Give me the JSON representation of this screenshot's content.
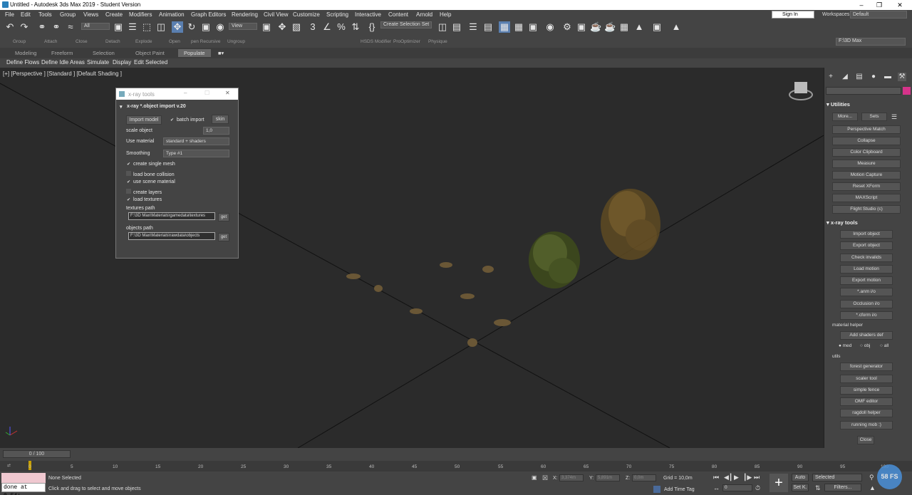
{
  "window": {
    "title": "Untitled - Autodesk 3ds Max 2019 - Student Version"
  },
  "menu": [
    "File",
    "Edit",
    "Tools",
    "Group",
    "Views",
    "Create",
    "Modifiers",
    "Animation",
    "Graph Editors",
    "Rendering",
    "Civil View",
    "Customize",
    "Scripting",
    "Interactive",
    "Content",
    "Arnold",
    "Help"
  ],
  "signin": "Sign In",
  "workspace": {
    "label": "Workspaces:",
    "value": "Default"
  },
  "toolbar": {
    "filter": "All",
    "view": "View",
    "selection_set": "Create Selection Set"
  },
  "toolbar2": [
    "Group",
    "Attach",
    "Close",
    "Detach",
    "Explode",
    "Open",
    "pen Recursive",
    "Ungroup",
    "HSDS Modifier",
    "ProOptimizer",
    "Physique"
  ],
  "project_path": "F:\\3D Max",
  "ribbon_tabs": [
    "Modeling",
    "Freeform",
    "Selection",
    "Object Paint",
    "Populate"
  ],
  "ribbon_active": "Populate",
  "ribbon_tools": [
    "Define Flows",
    "Define Idle Areas",
    "Simulate",
    "Display",
    "Edit Selected"
  ],
  "viewport_label": "[+] [Perspective ] [Standard ] [Default Shading ]",
  "dialog": {
    "title": "x-ray tools",
    "rollout": "x-ray *.object import v.20",
    "import_button": "Import model",
    "batch_import": "batch import",
    "skin_button": "skin",
    "scale_label": "scale object",
    "scale_value": "1,0",
    "material_label": "Use material",
    "material_value": "standard + shaders",
    "smoothing_label": "Smoothing",
    "smoothing_value": "Type #1",
    "opt_single_mesh": "create single mesh",
    "opt_bone_collision": "load bone collision",
    "opt_scene_material": "use scene material",
    "opt_layers": "create layers",
    "opt_textures": "load textures",
    "textures_label": "textures path",
    "textures_path": "F:\\3D Max\\Materials\\gamedata\\textures",
    "objects_label": "objects path",
    "objects_path": "F:\\3D Max\\Materials\\rawdata\\objects",
    "get": "get"
  },
  "utilities": {
    "header": "Utilities",
    "more": "More...",
    "sets": "Sets",
    "buttons": [
      "Perspective Match",
      "Collapse",
      "Color Clipboard",
      "Measure",
      "Motion Capture",
      "Reset XForm",
      "MAXScript",
      "Flight Studio (c)"
    ]
  },
  "xray_panel": {
    "header": "x-ray tools",
    "buttons": [
      "Import object",
      "Export object",
      "Check invalids",
      "Load motion",
      "Export motion",
      "*.anm i/o",
      "Occlusion i/o",
      "*.cform i/o"
    ],
    "material_helper": "material helper",
    "add_shaders": "Add shaders def",
    "radios": [
      "med",
      "obj",
      "all"
    ],
    "utils": "utils",
    "utils_buttons": [
      "forest generator",
      "scaler tool",
      "simple fence",
      "OMF editor",
      "ragdoll helper",
      "running mob :)"
    ],
    "close": "Close"
  },
  "timeline": {
    "frame": "0 / 100",
    "ticks": [
      "0",
      "5",
      "10",
      "15",
      "20",
      "25",
      "30",
      "35",
      "40",
      "45",
      "50",
      "55",
      "60",
      "65",
      "70",
      "75",
      "80",
      "85",
      "90",
      "95",
      "100"
    ]
  },
  "status": {
    "script": "done at 0.54:",
    "selection": "None Selected",
    "prompt": "Click and drag to select and move objects",
    "x": "3,374m",
    "y": "5,891m",
    "z": "0,0m",
    "grid": "Grid = 10,0m",
    "add_time_tag": "Add Time Tag",
    "auto": "Auto",
    "setk": "Set K.",
    "selected": "Selected",
    "filters": "Filters...",
    "frame_field": "0",
    "fps": "58 FS"
  },
  "colors": {
    "ui_bg": "#444444",
    "viewport": "#2b2b2b",
    "accent": "#4a90d9",
    "magenta": "#d6338a"
  }
}
